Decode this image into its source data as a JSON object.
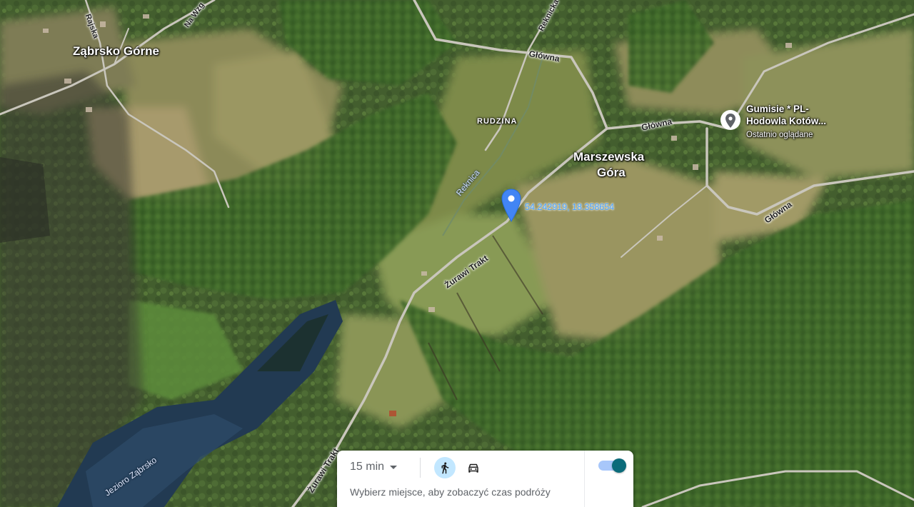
{
  "map": {
    "places": {
      "town_zabrsko": "Ząbrsko Górne",
      "town_marszewska_1": "Marszewska",
      "town_marszewska_2": "Góra",
      "hamlet_rudzina": "RUDZINA"
    },
    "roads": {
      "rajska": "Rajska",
      "na_wzg": "Na Wzg",
      "reknicka": "Reknicka",
      "glowna_1": "Główna",
      "glowna_2": "Główna",
      "glowna_3": "Główna",
      "zurawi_1": "Żurawi Trakt",
      "zurawi_2": "Żurawi Trakt"
    },
    "water": {
      "lake": "Jezioro Ząbrsko",
      "river": "Reknica"
    },
    "pin": {
      "coordinates": "54.242919, 18.358654",
      "color": "#4285f4"
    },
    "poi": {
      "name_line1": "Gumisie * PL-",
      "name_line2": "Hodowla Kotów...",
      "subtitle": "Ostatnio oglądane",
      "icon": "place-pin-icon"
    }
  },
  "panel": {
    "duration": "15 min",
    "mode_walk_icon": "walking-icon",
    "mode_car_icon": "car-icon",
    "toggle_state": "on",
    "hint": "Wybierz miejsce, aby zobaczyć czas podróży"
  }
}
